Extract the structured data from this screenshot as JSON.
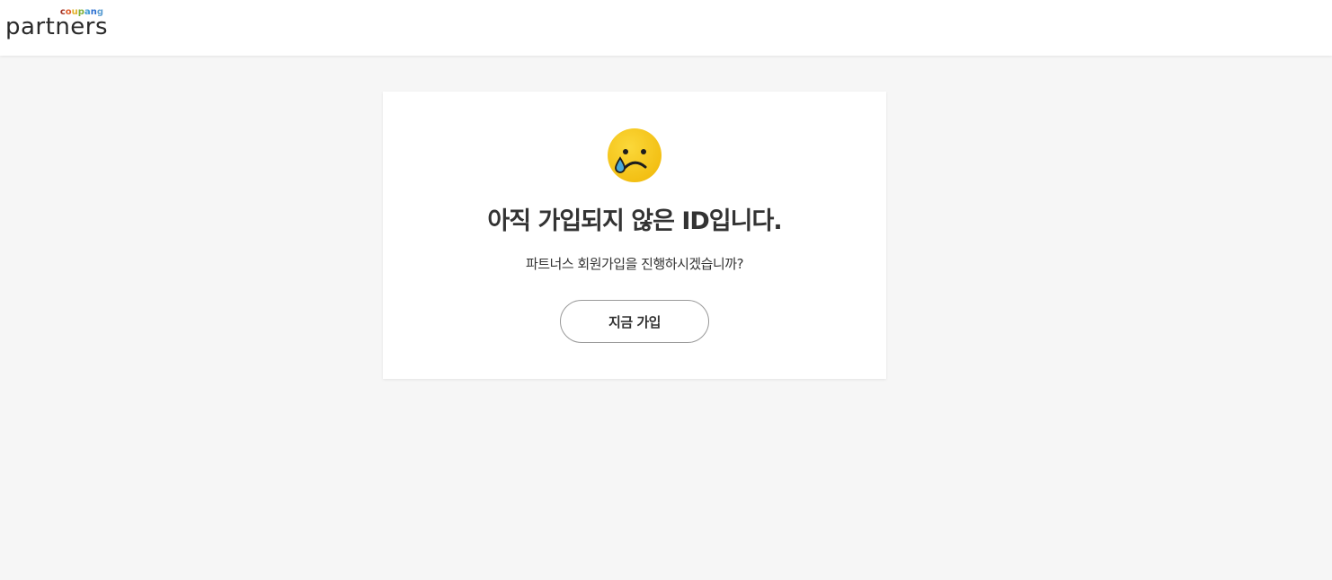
{
  "header": {
    "logo": {
      "top_text": "coupang",
      "top_text_colors": [
        "#a02d1f",
        "#e25c2a",
        "#e2b12a",
        "#7fb13a",
        "#3f9bd6",
        "#2c6fd1",
        "#5e9fd3"
      ],
      "main_text": "partners"
    }
  },
  "card": {
    "icon": "crying-face-icon",
    "title": "아직 가입되지 않은 ID입니다.",
    "subtitle": "파트너스 회원가입을 진행하시겠습니까?",
    "signup_button_label": "지금 가입"
  },
  "colors": {
    "page_background": "#f6f6f6",
    "card_background": "#ffffff",
    "text": "#333333",
    "emoji_yellow": "#f7c91c",
    "tear_blue": "#4aa9d8"
  }
}
